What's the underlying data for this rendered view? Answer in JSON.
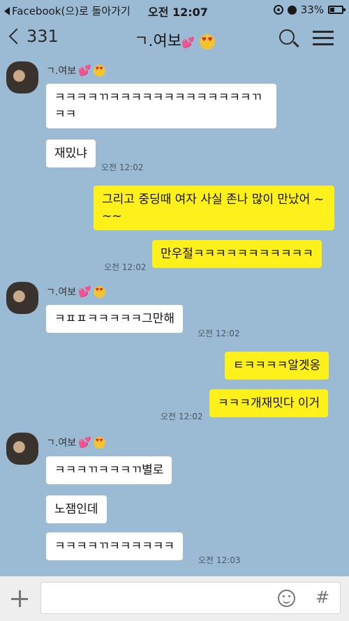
{
  "status_bar": {
    "back_app": "Facebook(으)로 돌아가기",
    "time": "오전 12:07",
    "battery": "33%"
  },
  "header": {
    "back_count": "331",
    "chat_title": "ㄱ.여보",
    "icons": [
      "chevron-left-icon",
      "search-icon",
      "menu-icon"
    ]
  },
  "messages": [
    {
      "side": "in",
      "sender": "ㄱ.여보",
      "text": "ㅋㅋㅋㅋㄲㅋㅋㅋㅋㅋㅋㅋㅋㅋㅋㅋㅋㅋㄲㅋㅋ"
    },
    {
      "side": "in",
      "text": "재밌냐",
      "time": "오전 12:02"
    },
    {
      "side": "out",
      "text": "그리고 중딩때 여자 사실 존나 많이 만났어 ~~~"
    },
    {
      "side": "out",
      "text": "만우절ㅋㅋㅋㅋㅋㅋㅋㅋㅋㅋㅋ",
      "time": "오전 12:02"
    },
    {
      "side": "in",
      "sender": "ㄱ.여보",
      "text": "ㅋㅍㅍㅋㅋㅋㅋㅋ그만해",
      "time": "오전 12:02"
    },
    {
      "side": "out",
      "text": "ㅌㅋㅋㅋㅋ알겟옹"
    },
    {
      "side": "out",
      "text": "ㅋㅋㅋ개재밋다 이거",
      "time": "오전 12:02"
    },
    {
      "side": "in",
      "sender": "ㄱ.여보",
      "text": "ㅋㅋㅋㄲㅋㅋㅋㄲ별로"
    },
    {
      "side": "in",
      "text": "노잼인데"
    },
    {
      "side": "in",
      "text": "ㅋㅋㅋㅋㄲㅋㅋㅋㅋㅋㅋ",
      "time": "오전 12:03"
    }
  ],
  "input_bar": {
    "placeholder": "",
    "hash_label": "#"
  },
  "colors": {
    "background": "#9bbbd4",
    "outgoing_bubble": "#fef01b",
    "incoming_bubble": "#ffffff"
  }
}
